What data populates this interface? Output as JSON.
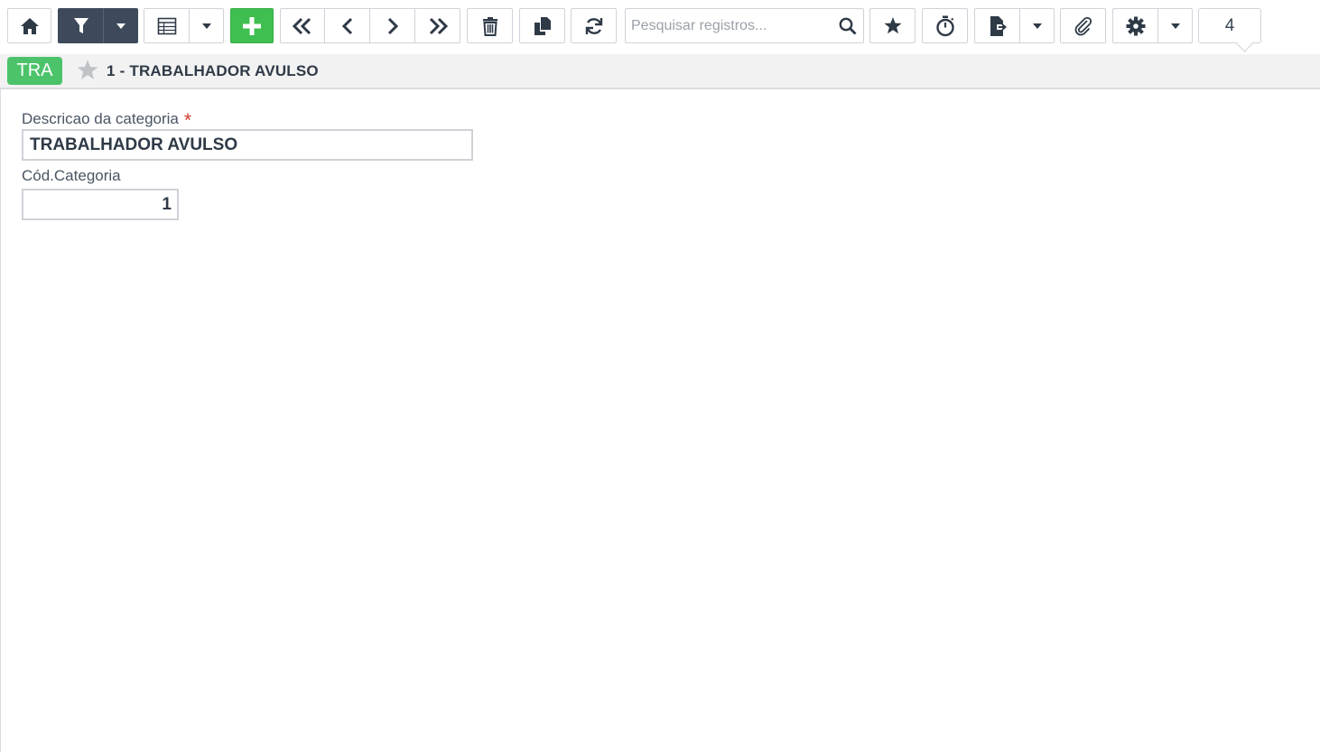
{
  "toolbar": {
    "home_icon": "home-icon",
    "filter_icon": "filter-icon",
    "grid_icon": "table-grid-icon",
    "add_icon": "plus-icon",
    "first_icon": "double-chevron-left-icon",
    "prev_icon": "chevron-left-icon",
    "next_icon": "chevron-right-icon",
    "last_icon": "double-chevron-right-icon",
    "delete_icon": "trash-icon",
    "copy_icon": "copy-icon",
    "refresh_icon": "refresh-icon",
    "favorite_icon": "star-icon",
    "timer_icon": "stopwatch-icon",
    "export_icon": "export-file-icon",
    "attach_icon": "paperclip-icon",
    "settings_icon": "gear-icon",
    "counter": "4"
  },
  "search": {
    "placeholder": "Pesquisar registros...",
    "value": ""
  },
  "record": {
    "badge": "TRA",
    "title": "1 - TRABALHADOR AVULSO"
  },
  "form": {
    "descricao_label": "Descricao da categoria",
    "required_mark": "*",
    "descricao_value": "TRABALHADOR AVULSO",
    "cod_label": "Cód.Categoria",
    "cod_value": "1"
  },
  "colors": {
    "dark_button": "#3e4a5c",
    "green_button": "#3fbf4f",
    "badge": "#4cc36a",
    "required": "#d23b2a"
  }
}
